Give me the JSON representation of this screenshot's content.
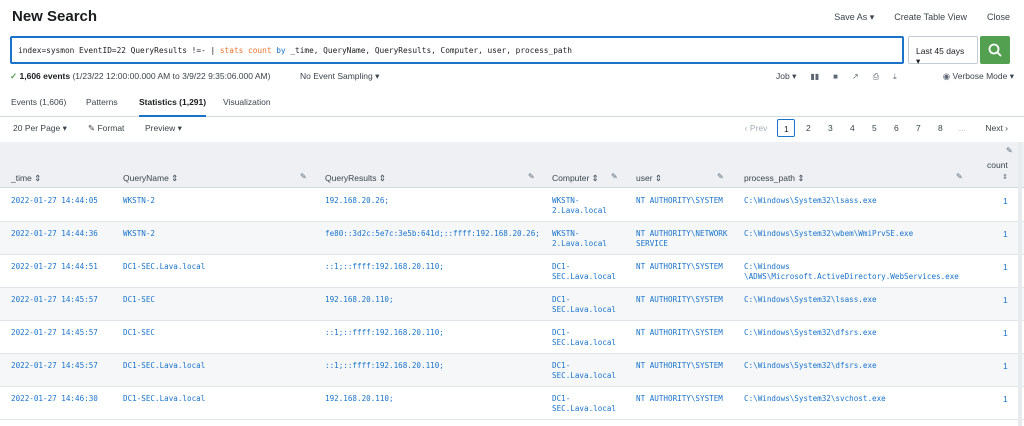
{
  "header": {
    "title": "New Search",
    "save_as": "Save As ▾",
    "create_table_view": "Create Table View",
    "close": "Close"
  },
  "search": {
    "q1": "index=sysmon EventID=22 QueryResults !=- | ",
    "q2": "stats",
    "q3": " ",
    "q4": "count",
    "q5": " ",
    "q6": "by",
    "q7": " _time, QueryName, QueryResults, Computer, user, process_path",
    "time_range": "Last 45 days ▾"
  },
  "status": {
    "events_count": "1,606 events",
    "events_range": " (1/23/22 12:00:00.000 AM to 3/9/22 9:35:06.000 AM)",
    "sampling": "No Event Sampling ▾",
    "job": "Job ▾",
    "verbose": "Verbose Mode ▾"
  },
  "tabs": [
    "Events (1,606)",
    "Patterns",
    "Statistics (1,291)",
    "Visualization"
  ],
  "toolbar": {
    "per_page": "20 Per Page ▾",
    "format": "Format",
    "preview": "Preview ▾"
  },
  "pager": {
    "prev": "‹ Prev",
    "pages": [
      "1",
      "2",
      "3",
      "4",
      "5",
      "6",
      "7",
      "8"
    ],
    "ellipsis": "...",
    "next": "Next ›"
  },
  "table": {
    "columns": [
      "_time ⇕",
      "QueryName ⇕",
      "QueryResults ⇕",
      "Computer ⇕",
      "user ⇕",
      "process_path ⇕",
      "count"
    ],
    "rows": [
      {
        "time": "2022-01-27 14:44:05",
        "query": "WKSTN-2",
        "results": "192.168.20.26;",
        "computer": "WKSTN-2.Lava.local",
        "user": "NT AUTHORITY\\SYSTEM",
        "path": "C:\\Windows\\System32\\lsass.exe",
        "count": "1"
      },
      {
        "time": "2022-01-27 14:44:36",
        "query": "WKSTN-2",
        "results": "fe80::3d2c:5e7c:3e5b:641d;::ffff:192.168.20.26;",
        "computer": "WKSTN-2.Lava.local",
        "user": "NT AUTHORITY\\NETWORK SERVICE",
        "path": "C:\\Windows\\System32\\wbem\\WmiPrvSE.exe",
        "count": "1"
      },
      {
        "time": "2022-01-27 14:44:51",
        "query": "DC1-SEC.Lava.local",
        "results": "::1;::ffff:192.168.20.110;",
        "computer": "DC1-SEC.Lava.local",
        "user": "NT AUTHORITY\\SYSTEM",
        "path": "C:\\Windows \\ADWS\\Microsoft.ActiveDirectory.WebServices.exe",
        "count": "1"
      },
      {
        "time": "2022-01-27 14:45:57",
        "query": "DC1-SEC",
        "results": "192.168.20.110;",
        "computer": "DC1-SEC.Lava.local",
        "user": "NT AUTHORITY\\SYSTEM",
        "path": "C:\\Windows\\System32\\lsass.exe",
        "count": "1"
      },
      {
        "time": "2022-01-27 14:45:57",
        "query": "DC1-SEC",
        "results": "::1;::ffff:192.168.20.110;",
        "computer": "DC1-SEC.Lava.local",
        "user": "NT AUTHORITY\\SYSTEM",
        "path": "C:\\Windows\\System32\\dfsrs.exe",
        "count": "1"
      },
      {
        "time": "2022-01-27 14:45:57",
        "query": "DC1-SEC.Lava.local",
        "results": "::1;::ffff:192.168.20.110;",
        "computer": "DC1-SEC.Lava.local",
        "user": "NT AUTHORITY\\SYSTEM",
        "path": "C:\\Windows\\System32\\dfsrs.exe",
        "count": "1"
      },
      {
        "time": "2022-01-27 14:46:30",
        "query": "DC1-SEC.Lava.local",
        "results": "192.168.20.110;",
        "computer": "DC1-SEC.Lava.local",
        "user": "NT AUTHORITY\\SYSTEM",
        "path": "C:\\Windows\\System32\\svchost.exe",
        "count": "1"
      }
    ]
  },
  "colors": {
    "accent": "#1a73c9",
    "search_button": "#53a051",
    "keyword": "#1a73c9",
    "command": "#e8732a"
  },
  "icons": {
    "search_button": "search-icon",
    "job_pause": "pause-icon",
    "job_stop": "stop-icon",
    "job_share": "share-icon",
    "job_print": "print-icon",
    "job_export": "download-icon",
    "verbose": "mode-icon",
    "format": "pencil-icon",
    "column_edit": "pencil-icon"
  }
}
